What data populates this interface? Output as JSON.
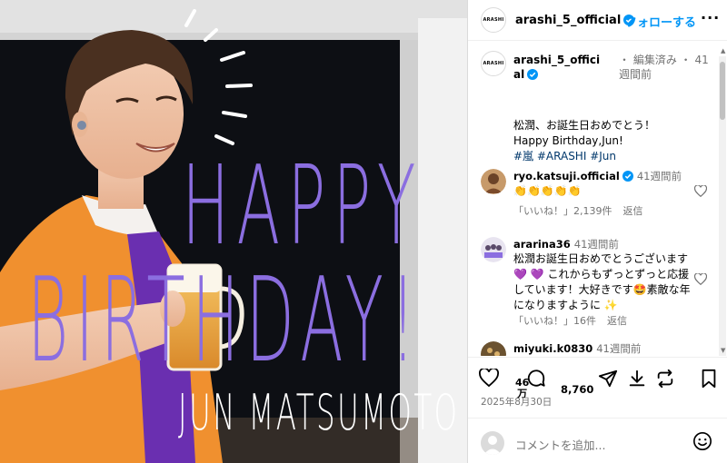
{
  "photo": {
    "headline_1": "HAPPY",
    "headline_2": "BIRTHDAY!",
    "name_line": "JUN MATSUMOTO",
    "accent_color": "#8b6ee0"
  },
  "header": {
    "avatar_text": "ARASHI",
    "username": "arashi_5_official",
    "follow_label": "フォローする",
    "more_icon": "more-dots-icon"
  },
  "caption": {
    "avatar_text": "ARASHI",
    "username": "arashi_5_official",
    "meta": "・ 編集済み ・ 41週間前",
    "lines": [
      "松潤、お誕生日おめでとう！",
      "Happy Birthday,Jun!"
    ],
    "hashtags": "#嵐 #ARASHI #Jun"
  },
  "comments": [
    {
      "user": "ryo.katsuji.official",
      "time": "41週間前",
      "text": "👏👏👏👏👏",
      "likes": "「いいね！」2,139件",
      "reply": "返信"
    },
    {
      "user": "ararina36",
      "time": "41週間前",
      "text": "松潤お誕生日おめでとうございます 💜 💜 これからもずっとずっと応援しています！大好きです🤩素敵な年になりますように ✨",
      "likes": "「いいね！」16件",
      "reply": "返信"
    },
    {
      "user": "miyuki.k0830",
      "time": "41週間前"
    }
  ],
  "actions": {
    "like_count": "46\n万",
    "comment_count": "8,760",
    "date": "2025年8月30日",
    "comment_placeholder": "コメントを追加...",
    "colors": {
      "link": "#0095f6",
      "hashtag": "#00376b",
      "muted": "#737373"
    }
  }
}
